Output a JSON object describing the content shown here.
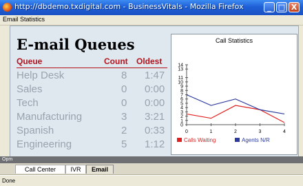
{
  "window": {
    "title": "http://dbdemo.txdigital.com - BusinessVitals - Mozilla Firefox",
    "buttons": {
      "minimize": "_",
      "maximize": "□",
      "close": "X"
    }
  },
  "menu": {
    "item": "Email Statistics"
  },
  "page": {
    "heading": "E-mail Queues",
    "columns": {
      "queue": "Queue",
      "count": "Count",
      "oldest": "Oldest"
    },
    "rows": [
      {
        "queue": "Help Desk",
        "count": "8",
        "oldest": "1:47"
      },
      {
        "queue": "Sales",
        "count": "0",
        "oldest": "0:00"
      },
      {
        "queue": "Tech",
        "count": "0",
        "oldest": "0:00"
      },
      {
        "queue": "Manufacturing",
        "count": "3",
        "oldest": "3:21"
      },
      {
        "queue": "Spanish",
        "count": "2",
        "oldest": "0:33"
      },
      {
        "queue": "Engineering",
        "count": "5",
        "oldest": "1:12"
      }
    ]
  },
  "chart_data": {
    "type": "line",
    "title": "Call Statistics",
    "x": [
      0,
      1,
      2,
      3,
      4
    ],
    "xlim": [
      0,
      4
    ],
    "ylim": [
      0,
      14
    ],
    "y_ticks": [
      0,
      1,
      2,
      3,
      4,
      5,
      6,
      7,
      8,
      9,
      10,
      11,
      13,
      14
    ],
    "legend_position": "bottom",
    "grid": false,
    "series": [
      {
        "name": "Calls Waiting",
        "color": "#e02020",
        "values": [
          2.5,
          1.5,
          4.5,
          3.5,
          0.5
        ]
      },
      {
        "name": "Agents N/R",
        "color": "#2b3a9c",
        "values": [
          7,
          4.5,
          6,
          3.5,
          2.5
        ]
      }
    ]
  },
  "status_strip": {
    "text": "Opm"
  },
  "tabs": [
    {
      "label": "Call Center",
      "active": false
    },
    {
      "label": "IVR",
      "active": false
    },
    {
      "label": "Email",
      "active": true
    }
  ],
  "statusbar": {
    "text": "Done"
  }
}
